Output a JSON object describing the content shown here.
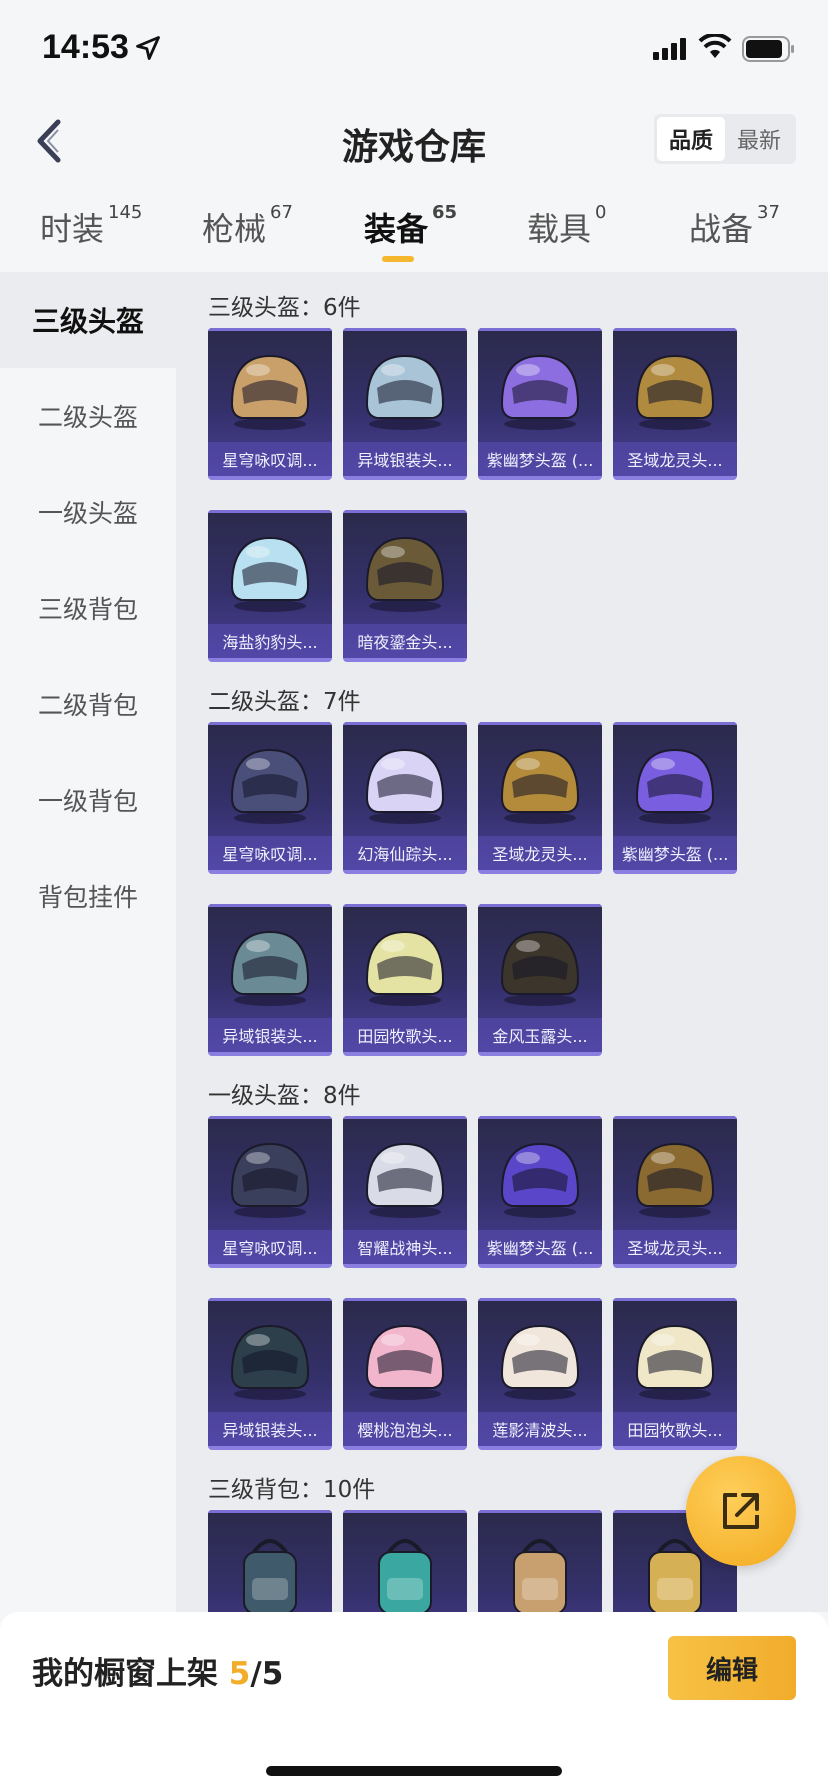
{
  "status": {
    "time": "14:53"
  },
  "header": {
    "title": "游戏仓库",
    "sort_quality": "品质",
    "sort_newest": "最新"
  },
  "tabs": [
    {
      "label": "时装",
      "count": "145"
    },
    {
      "label": "枪械",
      "count": "67"
    },
    {
      "label": "装备",
      "count": "65"
    },
    {
      "label": "载具",
      "count": "0"
    },
    {
      "label": "战备",
      "count": "37"
    }
  ],
  "sidebar": {
    "items": [
      {
        "label": "三级头盔"
      },
      {
        "label": "二级头盔"
      },
      {
        "label": "一级头盔"
      },
      {
        "label": "三级背包"
      },
      {
        "label": "二级背包"
      },
      {
        "label": "一级背包"
      },
      {
        "label": "背包挂件"
      }
    ]
  },
  "sections": [
    {
      "title": "三级头盔：6件",
      "items": [
        {
          "name": "星穹咏叹调...",
          "color": "#c9a06a"
        },
        {
          "name": "异域银装头...",
          "color": "#a9c4d6"
        },
        {
          "name": "紫幽梦头盔 (...",
          "color": "#8c6ee0"
        },
        {
          "name": "圣域龙灵头...",
          "color": "#b08a3e"
        },
        {
          "name": "海盐豹豹头...",
          "color": "#b9e0f0"
        },
        {
          "name": "暗夜鎏金头...",
          "color": "#6a5a38"
        }
      ]
    },
    {
      "title": "二级头盔：7件",
      "items": [
        {
          "name": "星穹咏叹调...",
          "color": "#4a4f7a"
        },
        {
          "name": "幻海仙踪头...",
          "color": "#d9d3f5"
        },
        {
          "name": "圣域龙灵头...",
          "color": "#b38b3a"
        },
        {
          "name": "紫幽梦头盔 (...",
          "color": "#7a5ee0"
        },
        {
          "name": "异域银装头...",
          "color": "#6a8a96"
        },
        {
          "name": "田园牧歌头...",
          "color": "#e4e3a4"
        },
        {
          "name": "金风玉露头...",
          "color": "#3c352c"
        }
      ]
    },
    {
      "title": "一级头盔：8件",
      "items": [
        {
          "name": "星穹咏叹调...",
          "color": "#3a3f5c"
        },
        {
          "name": "智耀战神头...",
          "color": "#d9dbe6"
        },
        {
          "name": "紫幽梦头盔 (...",
          "color": "#5a46c8"
        },
        {
          "name": "圣域龙灵头...",
          "color": "#8a6a30"
        },
        {
          "name": "异域银装头...",
          "color": "#2c3f4a"
        },
        {
          "name": "樱桃泡泡头...",
          "color": "#f2b6cc"
        },
        {
          "name": "莲影清波头...",
          "color": "#f0e6dc"
        },
        {
          "name": "田园牧歌头...",
          "color": "#efe7c8"
        }
      ]
    },
    {
      "title": "三级背包：10件",
      "items": [
        {
          "name": "",
          "color": "#3f5a6a"
        },
        {
          "name": "",
          "color": "#3aa8a0"
        },
        {
          "name": "",
          "color": "#c8a070"
        },
        {
          "name": "",
          "color": "#d6b054"
        }
      ]
    }
  ],
  "bottom": {
    "showcase_label": "我的橱窗上架 ",
    "showcase_used": "5",
    "showcase_total": "/5",
    "edit": "编辑"
  }
}
